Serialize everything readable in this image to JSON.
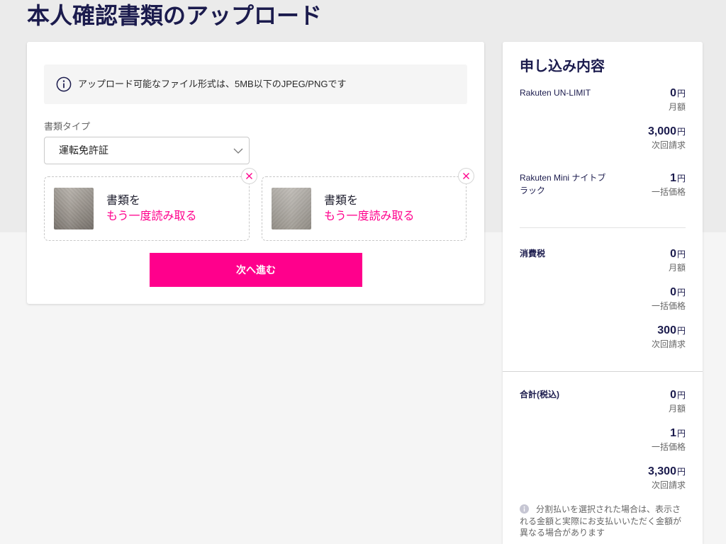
{
  "page": {
    "title": "本人確認書類のアップロード"
  },
  "upload_form": {
    "info": {
      "icon": "info-icon",
      "text": "アップロード可能なファイル形式は、5MB以下のJPEG/PNGです"
    },
    "document_type": {
      "label": "書類タイプ",
      "selected": "運転免許証",
      "icon": "chevron-down-icon"
    },
    "documents": [
      {
        "line1": "書類を",
        "rescan_label": "もう一度読み取る",
        "remove_icon": "close-icon"
      },
      {
        "line1": "書類を",
        "rescan_label": "もう一度読み取る",
        "remove_icon": "close-icon"
      }
    ],
    "next_button": "次へ進む"
  },
  "order_summary": {
    "title": "申し込み内容",
    "currency": "円",
    "items": [
      {
        "name": "Rakuten UN-LIMIT",
        "prices": [
          {
            "amount": "0",
            "label": "月額"
          },
          {
            "amount": "3,000",
            "label": "次回請求"
          }
        ]
      },
      {
        "name": "Rakuten Mini ナイトブラック",
        "prices": [
          {
            "amount": "1",
            "label": "一括価格"
          }
        ]
      }
    ],
    "tax": {
      "name": "消費税",
      "prices": [
        {
          "amount": "0",
          "label": "月額"
        },
        {
          "amount": "0",
          "label": "一括価格"
        },
        {
          "amount": "300",
          "label": "次回請求"
        }
      ]
    },
    "total": {
      "name": "合計(税込)",
      "prices": [
        {
          "amount": "0",
          "label": "月額"
        },
        {
          "amount": "1",
          "label": "一括価格"
        },
        {
          "amount": "3,300",
          "label": "次回請求"
        }
      ]
    },
    "note": {
      "icon": "info-icon",
      "text": "分割払いを選択された場合は、表示される金額と実際にお支払いいただく金額が異なる場合があります"
    }
  },
  "colors": {
    "brand_pink": "#ff008c",
    "navy": "#1b1b4d",
    "page_bg_top": "#ebebeb",
    "page_bg": "#f5f5f5"
  }
}
